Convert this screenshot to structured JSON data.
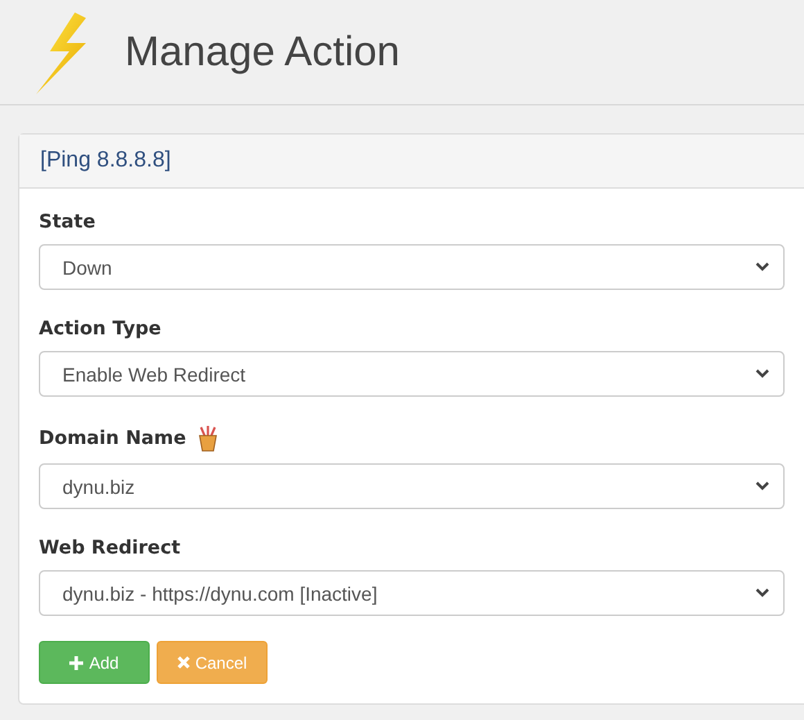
{
  "header": {
    "title": "Manage Action"
  },
  "panel": {
    "title": "[Ping 8.8.8.8]"
  },
  "fields": [
    {
      "label": "State",
      "value": "Down",
      "help": false
    },
    {
      "label": "Action Type",
      "value": "Enable Web Redirect",
      "help": false
    },
    {
      "label": "Domain Name",
      "value": "dynu.biz",
      "help": true
    },
    {
      "label": "Web Redirect",
      "value": "dynu.biz - https://dynu.com [Inactive]",
      "help": false
    }
  ],
  "buttons": [
    {
      "label": "Add",
      "kind": "add"
    },
    {
      "label": "Cancel",
      "kind": "cancel"
    }
  ]
}
